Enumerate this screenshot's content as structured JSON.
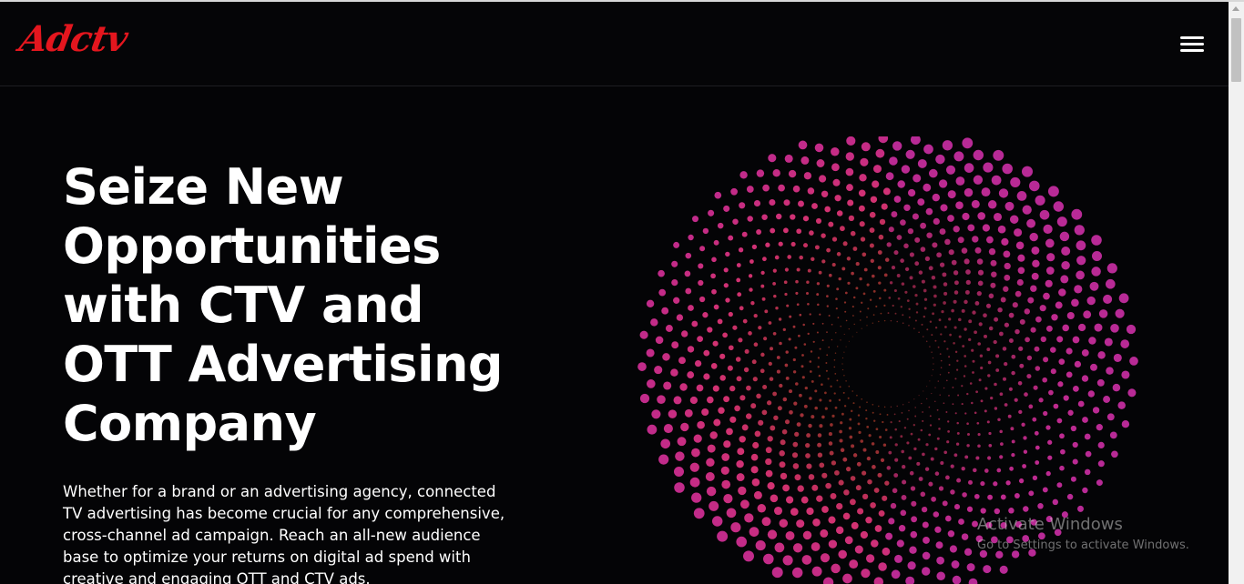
{
  "header": {
    "logo_text": "Adctv",
    "menu_icon": "hamburger-menu-icon"
  },
  "hero": {
    "title_lines": [
      "Seize New",
      "Opportunities",
      "with CTV and",
      "OTT Advertising",
      "Company"
    ],
    "description": "Whether for a brand or an advertising agency, connected TV advertising has become crucial for any comprehensive, cross-channel ad campaign. Reach an all-new audience base to optimize your returns on digital ad spend with creative and engaging OTT and CTV ads."
  },
  "graphic": {
    "name": "dotted-spiral-graphic",
    "colors": [
      "#e8542a",
      "#d8346a",
      "#c02a8c",
      "#b82a96"
    ]
  },
  "watermark": {
    "title": "Activate Windows",
    "subtitle": "Go to Settings to activate Windows."
  }
}
